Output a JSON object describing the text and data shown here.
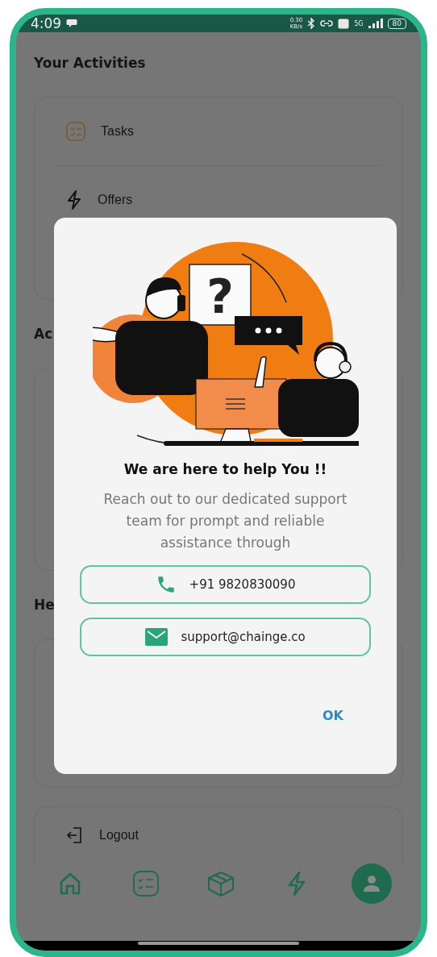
{
  "status_bar": {
    "time": "4:09",
    "net_speed": "0.30",
    "net_unit": "KB/s",
    "network": "5G",
    "battery": "80"
  },
  "sections": [
    {
      "title": "Your Activities",
      "items": [
        {
          "label": "Tasks",
          "kind": "tasks"
        },
        {
          "label": "Offers",
          "kind": "bolt"
        }
      ]
    },
    {
      "title": "Ac"
    },
    {
      "title": "He"
    }
  ],
  "logout": {
    "label": "Logout"
  },
  "nav": [
    {
      "kind": "home",
      "selected": false
    },
    {
      "kind": "tasks",
      "selected": false
    },
    {
      "kind": "box",
      "selected": false
    },
    {
      "kind": "bolt",
      "selected": false
    },
    {
      "kind": "profile",
      "selected": true
    }
  ],
  "dialog": {
    "illustration_mark": "?",
    "title": "We are here to help You !!",
    "message": "Reach out to our dedicated support team for prompt and reliable assistance through",
    "contacts": [
      {
        "kind": "phone",
        "label": "+91 9820830090"
      },
      {
        "kind": "email",
        "label": "support@chainge.co"
      }
    ],
    "ok": "OK"
  }
}
